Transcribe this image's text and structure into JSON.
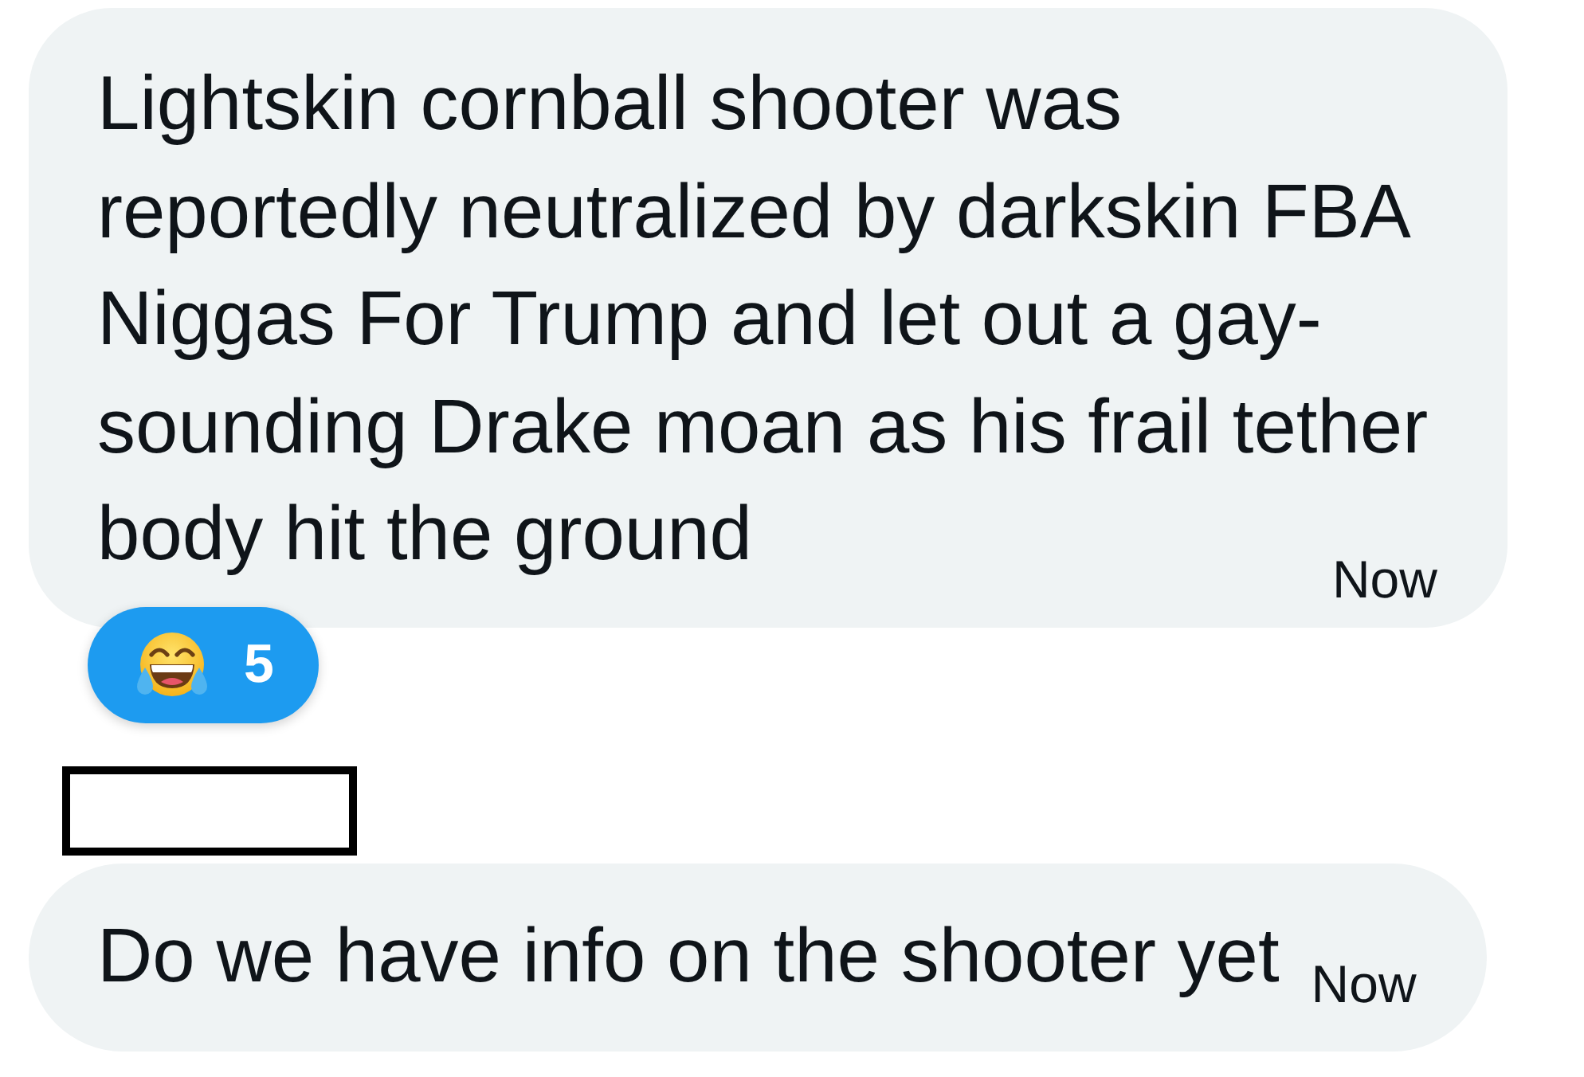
{
  "conversation": [
    {
      "kind": "message",
      "text": "Lightskin cornball shooter was reportedly neutralized by darkskin FBA Niggas For Trump and let out a gay-sounding Drake moan as his frail tether body hit the ground",
      "time": "Now",
      "reactions": [
        {
          "count": "5",
          "selected": true
        }
      ]
    },
    {
      "kind": "redaction"
    },
    {
      "kind": "message",
      "text": "Do we have info on the shooter yet",
      "time": "Now"
    }
  ]
}
